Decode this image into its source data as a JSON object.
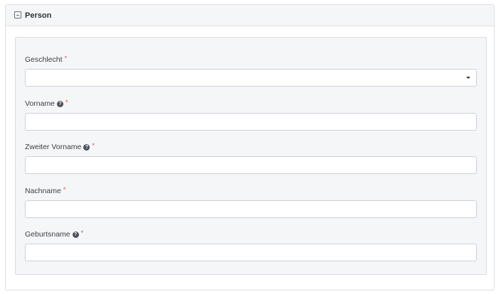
{
  "panel": {
    "title": "Person",
    "collapse_icon": "collapse-minus-icon"
  },
  "form": {
    "required_marker": "*",
    "help_glyph": "?",
    "fields": [
      {
        "label": "Geschlecht",
        "type": "select",
        "value": "",
        "has_help": false,
        "required": true
      },
      {
        "label": "Vorname",
        "type": "text",
        "value": "",
        "has_help": true,
        "required": true
      },
      {
        "label": "Zweiter Vorname",
        "type": "text",
        "value": "",
        "has_help": true,
        "required": true
      },
      {
        "label": "Nachname",
        "type": "text",
        "value": "",
        "has_help": false,
        "required": true
      },
      {
        "label": "Geburtsname",
        "type": "text",
        "value": "",
        "has_help": true,
        "required": true
      }
    ]
  },
  "colors": {
    "required": "#e04a4a",
    "header_bg": "#f5f6f7",
    "card_bg": "#f5f6f8",
    "border": "#ccd1d7"
  }
}
